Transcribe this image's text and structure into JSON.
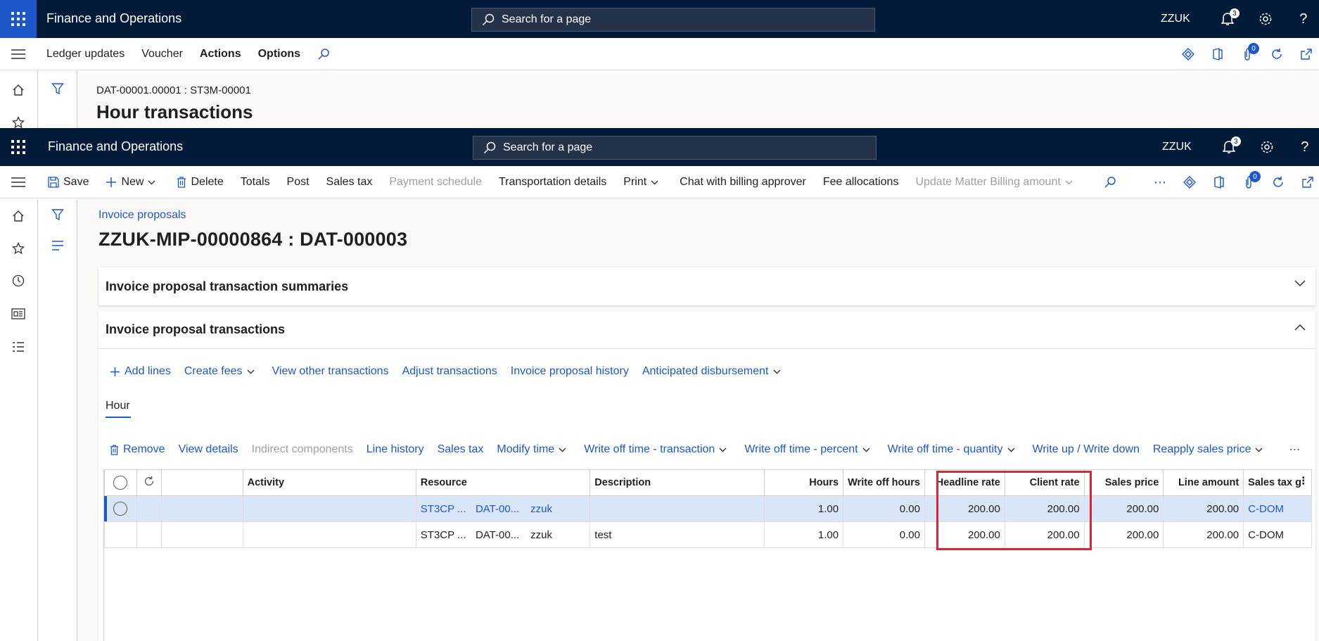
{
  "app": {
    "title": "Finance and Operations",
    "company": "ZZUK",
    "search_placeholder": "Search for a page",
    "notification_count": "3"
  },
  "background_form": {
    "actions": [
      "Ledger updates",
      "Voucher",
      "Actions",
      "Options"
    ],
    "caption": "DAT-00001.00001 : ST3M-00001",
    "title": "Hour transactions",
    "attachments_count": "0"
  },
  "toolbar": {
    "save": "Save",
    "new": "New",
    "delete": "Delete",
    "totals": "Totals",
    "post": "Post",
    "sales_tax": "Sales tax",
    "payment_schedule": "Payment schedule",
    "transportation_details": "Transportation details",
    "print": "Print",
    "chat": "Chat with billing approver",
    "fee_allocations": "Fee allocations",
    "update_matter": "Update Matter Billing amount",
    "more": "⋯",
    "attachments_count": "0"
  },
  "page": {
    "breadcrumb": "Invoice proposals",
    "title": "ZZUK-MIP-00000864 : DAT-000003"
  },
  "fasttabs": {
    "summaries": "Invoice proposal transaction summaries",
    "transactions": "Invoice proposal transactions"
  },
  "transactions_actions": {
    "add_lines": "Add lines",
    "create_fees": "Create fees",
    "view_other": "View other transactions",
    "adjust": "Adjust transactions",
    "history": "Invoice proposal history",
    "anticipated": "Anticipated disbursement"
  },
  "tab": {
    "hour": "Hour"
  },
  "grid_actions": {
    "remove": "Remove",
    "view_details": "View details",
    "indirect": "Indirect components",
    "line_history": "Line history",
    "sales_tax": "Sales tax",
    "modify_time": "Modify time",
    "wo_transaction": "Write off time - transaction",
    "wo_percent": "Write off time - percent",
    "wo_quantity": "Write off time - quantity",
    "write_up_down": "Write up / Write down",
    "reapply": "Reapply sales price",
    "more": "⋯"
  },
  "grid": {
    "headers": {
      "activity": "Activity",
      "resource": "Resource",
      "description": "Description",
      "hours": "Hours",
      "write_off_hours": "Write off hours",
      "headline_rate": "Headline rate",
      "client_rate": "Client rate",
      "sales_price": "Sales price",
      "line_amount": "Line amount",
      "sales_tax_group": "Sales tax g"
    },
    "rows": [
      {
        "activity": "",
        "res1": "ST3CP ...",
        "res2": "DAT-00...",
        "res3": "zzuk",
        "description": "",
        "hours": "1.00",
        "write_off_hours": "0.00",
        "headline_rate": "200.00",
        "client_rate": "200.00",
        "sales_price": "200.00",
        "line_amount": "200.00",
        "sales_tax_group": "C-DOM"
      },
      {
        "activity": "",
        "res1": "ST3CP ...",
        "res2": "DAT-00...",
        "res3": "zzuk",
        "description": "test",
        "hours": "1.00",
        "write_off_hours": "0.00",
        "headline_rate": "200.00",
        "client_rate": "200.00",
        "sales_price": "200.00",
        "line_amount": "200.00",
        "sales_tax_group": "C-DOM"
      }
    ]
  },
  "colors": {
    "navbar": "#031a38",
    "accent": "#1d57c9",
    "highlight": "#e0232e"
  }
}
